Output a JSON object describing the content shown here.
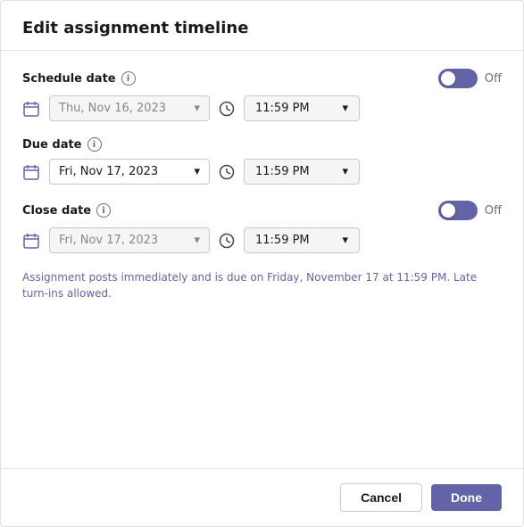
{
  "dialog": {
    "title": "Edit assignment timeline"
  },
  "schedule_date": {
    "label": "Schedule date",
    "toggle_state": "Off",
    "date_placeholder": "Thu, Nov 16, 2023",
    "time_value": "11:59 PM",
    "disabled": true
  },
  "due_date": {
    "label": "Due date",
    "date_value": "Fri, Nov 17, 2023",
    "time_value": "11:59 PM",
    "disabled": false
  },
  "close_date": {
    "label": "Close date",
    "toggle_state": "Off",
    "date_placeholder": "Fri, Nov 17, 2023",
    "time_value": "11:59 PM",
    "disabled": true
  },
  "info_text": "Assignment posts immediately and is due on Friday, November 17 at 11:59 PM. Late turn-ins allowed.",
  "footer": {
    "cancel_label": "Cancel",
    "done_label": "Done"
  }
}
